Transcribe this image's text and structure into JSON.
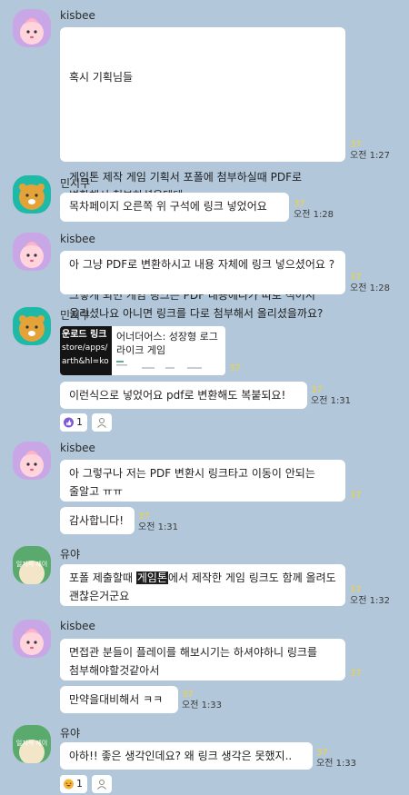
{
  "messages": [
    {
      "sender": "kisbee",
      "avatar": "peach-character-avatar",
      "lines": [
        "혹시 기획님들",
        "",
        "게임톤 제작 게임 기획서 포폴에 첨부하실때 PDF로 변환해서 첨부하셨을텐데..",
        "",
        "그렇게 되면 게임 링크는 PDF 내용에다가 따로 적어서 올리셨나요 아니면 링크를 다로 첨부해서 올리셨을까요?"
      ],
      "unread": "37",
      "time": "오전 1:27"
    },
    {
      "sender": "민시쿠",
      "avatar": "lion-character-avatar",
      "text": "목차페이지 오른쪽 위 구석에 링크 넣었어요",
      "unread": "37",
      "time": "오전 1:28"
    },
    {
      "sender": "kisbee",
      "avatar": "peach-character-avatar",
      "text": "아 그냥 PDF로 변환하시고 내용 자체에 링크 넣으셨어요 ?",
      "unread": "37",
      "time": "오전 1:28"
    },
    {
      "sender": "민시쿠",
      "avatar": "lion-character-avatar",
      "link_card": {
        "thumb_lines": [
          "운로드 링크",
          "store/apps/",
          "arth&hl=ko"
        ],
        "title": "어너더어스: 성장형 로그라이크 게임"
      },
      "card_unread": "37",
      "text": "이런식으로 넣었어요 pdf로 변환해도 복붙되요!",
      "unread": "37",
      "time": "오전 1:31",
      "reaction": {
        "icon": "thumbs-up-icon",
        "count": "1"
      }
    },
    {
      "sender": "kisbee",
      "avatar": "peach-character-avatar",
      "text": "아 그렇구나 저는 PDF 변환시 링크타고 이동이 안되는 줄알고 ㅠㅠ",
      "unread": "37",
      "text2": "감사합니다!",
      "unread2": "37",
      "time2": "오전 1:31"
    },
    {
      "sender": "유야",
      "avatar": "beanie-character-avatar",
      "avatar_text": "일지적 제이",
      "text_before": "포폴 제출할때 ",
      "text_hl": "게임톤",
      "text_after": "에서 제작한 게임 링크도 함께 올려도 괜찮은거군요",
      "unread": "37",
      "time": "오전 1:32"
    },
    {
      "sender": "kisbee",
      "avatar": "peach-character-avatar",
      "text": "면접관 분들이 플레이를 해보시기는 하셔야하니 링크를 첨부해야할것같아서",
      "unread": "37",
      "text2": "만약을대비해서 ㅋㅋ",
      "unread2": "37",
      "time2": "오전 1:33"
    },
    {
      "sender": "유야",
      "avatar": "beanie-character-avatar",
      "avatar_text": "일지적 제이",
      "text": "아하!! 좋은 생각인데요? 왜 링크 생각은 못했지..",
      "unread": "37",
      "time": "오전 1:33",
      "reaction": {
        "icon": "laughing-face-icon",
        "count": "1"
      }
    }
  ],
  "colors": {
    "background": "#b2c7d9",
    "bubble": "#ffffff",
    "unread": "#f2d23a",
    "highlight": "#1e1e1e"
  }
}
